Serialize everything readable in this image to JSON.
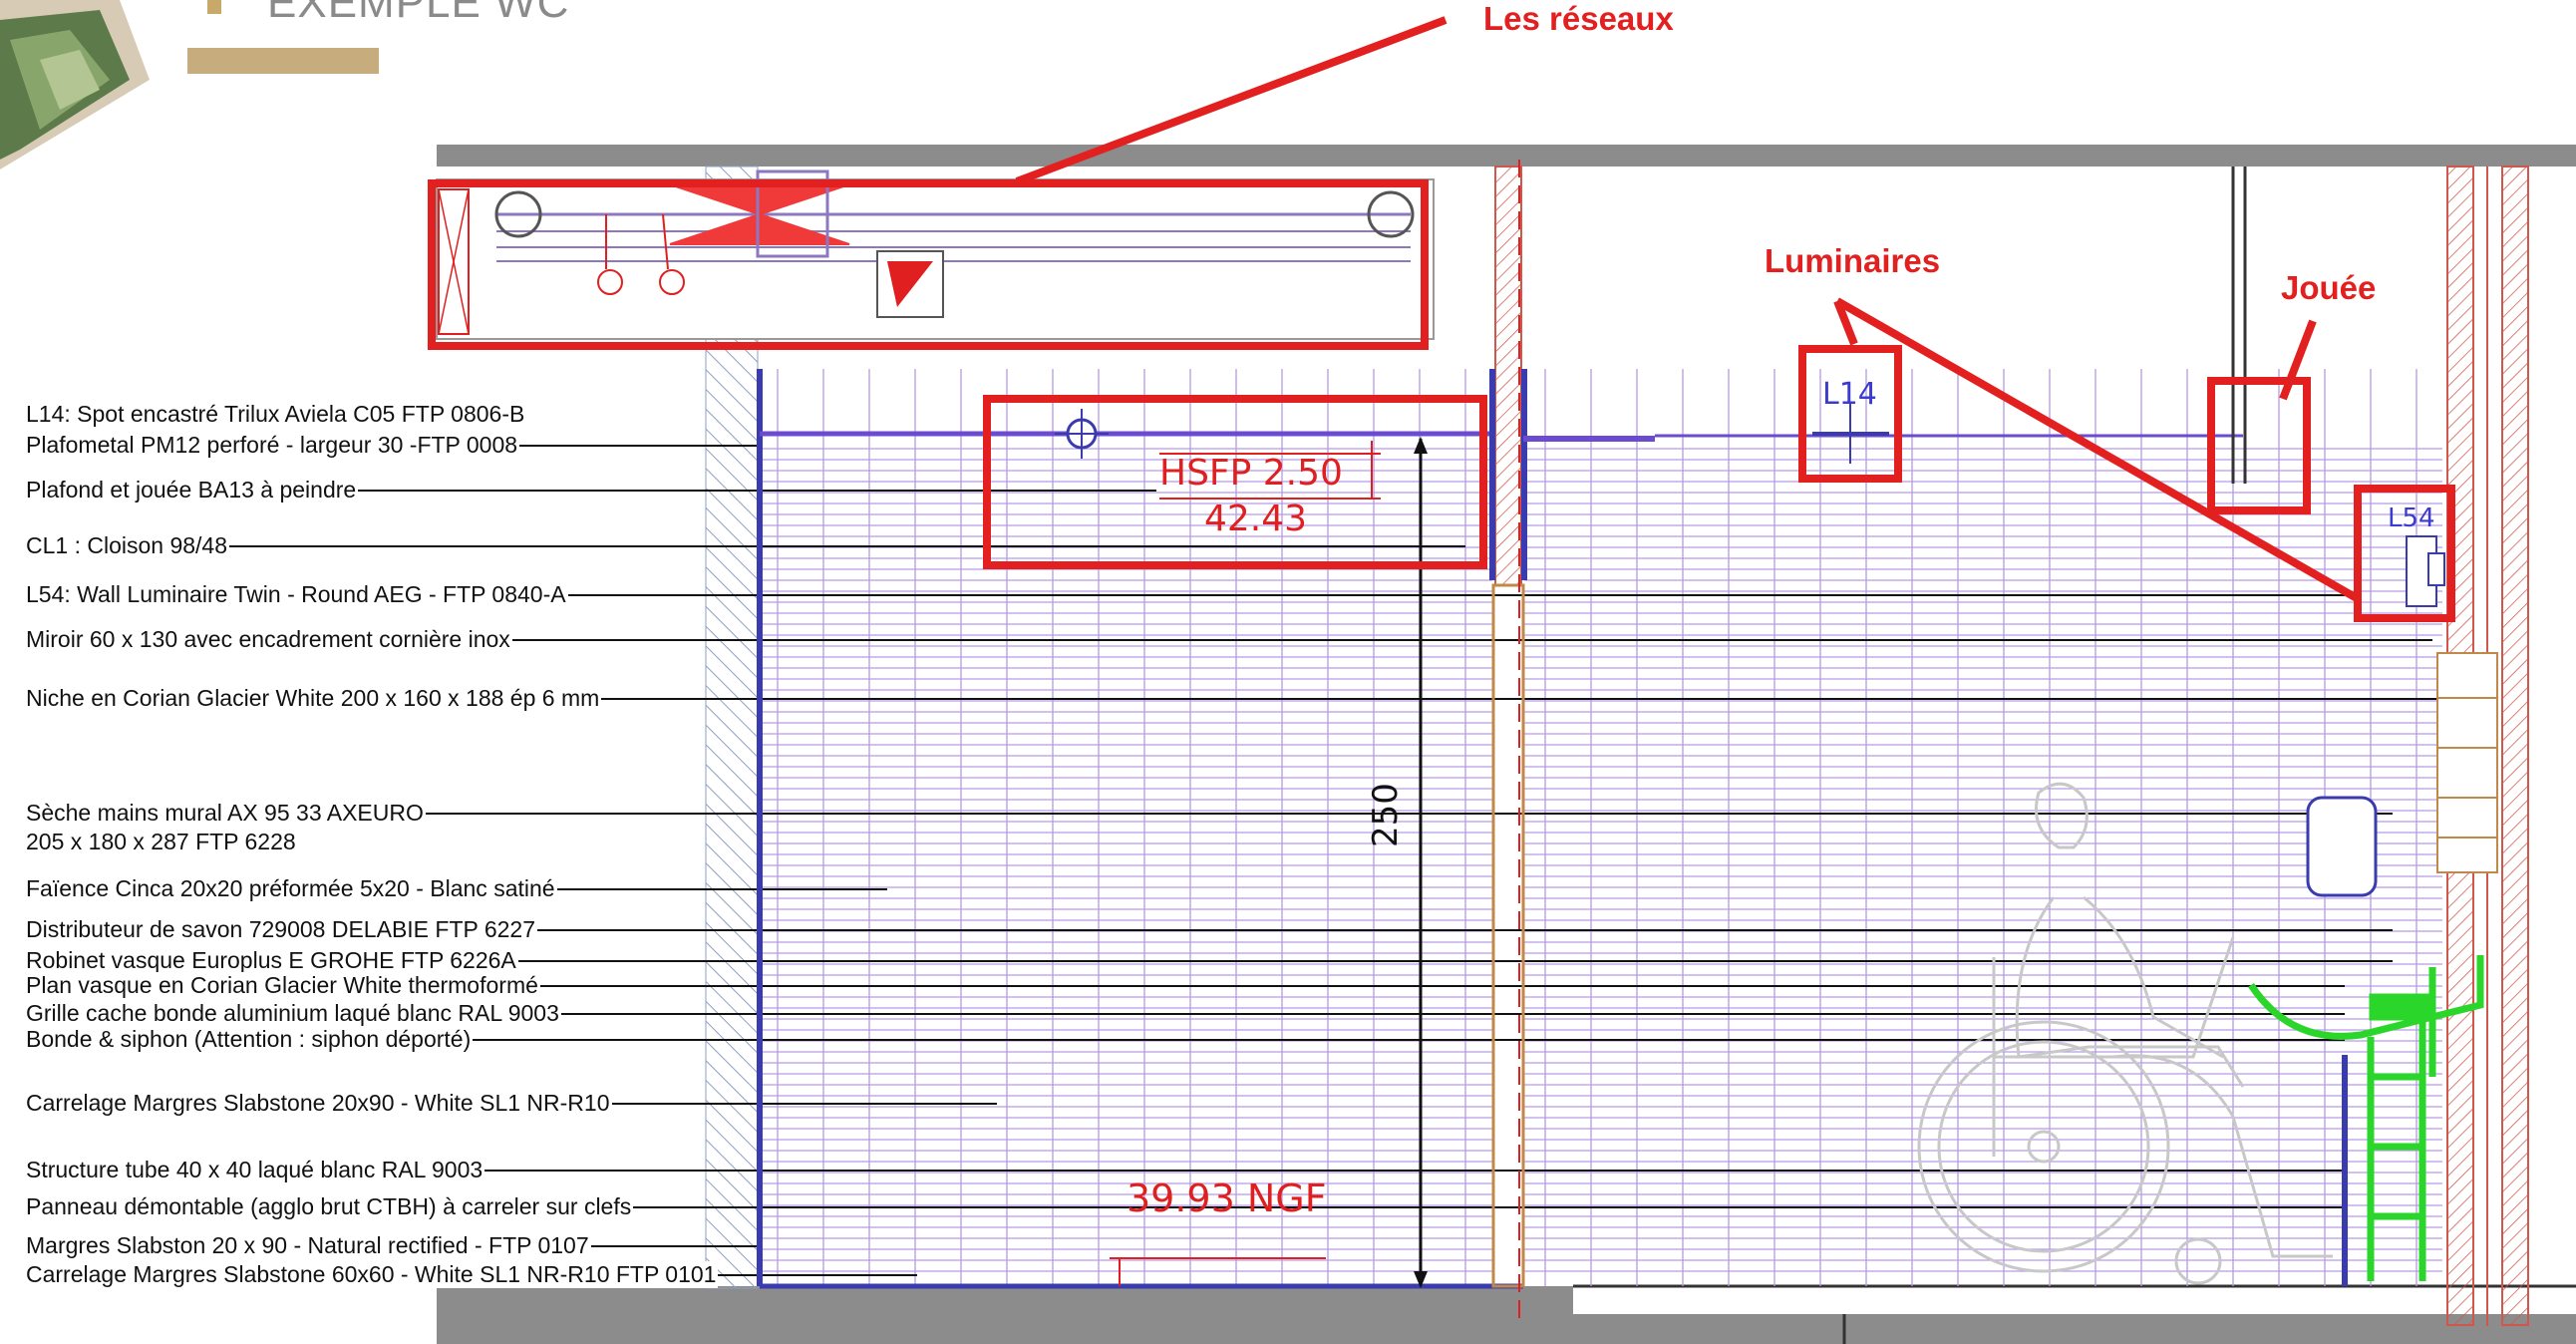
{
  "header": {
    "title": "EXEMPLE WC",
    "accent_color": "#c7ad7e"
  },
  "callouts": {
    "reseaux": "Les réseaux",
    "luminaires": "Luminaires",
    "jouee": "Jouée"
  },
  "drawing": {
    "level_hsfp": "HSFP 2.50",
    "level_hsfp_value": "42.43",
    "level_floor": "39.93 NGF",
    "height_dim": "250",
    "tag_l14": "L14",
    "tag_l54": "L54"
  },
  "legend_labels": [
    "L14: Spot encastré Trilux Aviela C05 FTP 0806-B",
    "Plafometal PM12 perforé - largeur 30 -FTP 0008",
    "Plafond et jouée BA13 à peindre",
    "CL1 : Cloison 98/48",
    "L54: Wall Luminaire Twin - Round AEG - FTP 0840-A",
    "Miroir 60 x 130 avec encadrement cornière inox",
    "Niche en Corian Glacier White 200 x 160 x 188  ép 6 mm",
    "Sèche mains mural AX 95 33 AXEURO",
    "205 x 180 x 287 FTP 6228",
    "Faïence Cinca 20x20 préformée 5x20 - Blanc satiné",
    "Distributeur de savon 729008 DELABIE FTP 6227",
    "Robinet vasque Europlus E GROHE  FTP 6226A",
    "Plan vasque en Corian Glacier White thermoformé",
    "Grille cache bonde aluminium laqué blanc RAL 9003",
    "Bonde & siphon (Attention : siphon déporté)",
    "Carrelage Margres Slabstone 20x90 - White SL1 NR-R10",
    "Structure tube 40 x 40 laqué blanc RAL 9003",
    "Panneau démontable (agglo brut CTBH) à carreler sur clefs",
    "Margres Slabston 20 x 90 - Natural rectified - FTP 0107",
    "Carrelage Margres Slabstone 60x60 - White SL1 NR-R10 FTP 0101"
  ],
  "colors": {
    "callout_red": "#e32020",
    "grid_violet": "#b79ae6",
    "wall_pink": "#e8a79a",
    "equipment_green": "#2bd62b"
  }
}
